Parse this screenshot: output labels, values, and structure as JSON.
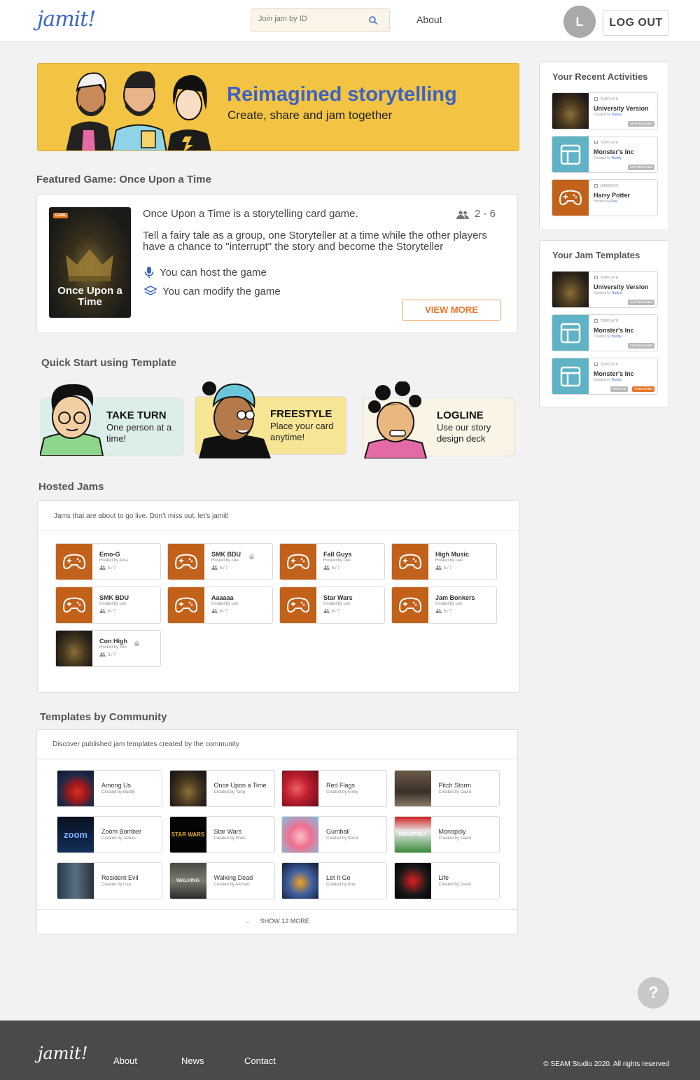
{
  "header": {
    "logo": "jamit!",
    "search_placeholder": "Join jam by ID",
    "nav_about": "About",
    "avatar_initial": "L",
    "logout_label": "LOG OUT"
  },
  "banner": {
    "title": "Reimagined storytelling",
    "subtitle": "Create, share and jam together"
  },
  "featured": {
    "section_title": "Featured Game: Once Upon a Time",
    "cover_badge": "GAME",
    "cover_title": "Once Upon a Time",
    "line1": "Once Upon a Time is a storytelling card game.",
    "players": "2 - 6",
    "description": "Tell a fairy tale as a group, one Storyteller at a time while the other players have a chance to \"interrupt\" the story and become the Storyteller",
    "host_text": "You can host the game",
    "modify_text": "You can modify the game",
    "view_more": "VIEW MORE"
  },
  "quickstart": {
    "section_title": "Quick Start using Template",
    "cards": [
      {
        "title": "TAKE TURN",
        "desc": "One person at a time!",
        "bg": "#dceee9"
      },
      {
        "title": "FREESTYLE",
        "desc": "Place your card anytime!",
        "bg": "#f5e595"
      },
      {
        "title": "LOGLINE",
        "desc": "Use our story design deck",
        "bg": "#f9f4e6"
      }
    ]
  },
  "hosted": {
    "section_title": "Hosted Jams",
    "subtitle": "Jams that are about to go live. Don’t miss out, let’s jamit!",
    "jams": [
      {
        "name": "Emo-G",
        "host": "Hosted by Avra",
        "count": "5 / 7",
        "locked": false
      },
      {
        "name": "SMK BDU",
        "host": "Hosted by Lee",
        "count": "6 / 7",
        "locked": true
      },
      {
        "name": "Fall Guys",
        "host": "Hosted by Lee",
        "count": "6 / 7",
        "locked": false
      },
      {
        "name": "High Music",
        "host": "Hosted by Lee",
        "count": "5 / 7",
        "locked": false
      },
      {
        "name": "SMK BDU",
        "host": "Hosted by Lee",
        "count": "6 / 7",
        "locked": false
      },
      {
        "name": "Aaaaaa",
        "host": "Hosted by Lee",
        "count": "6 / 7",
        "locked": false
      },
      {
        "name": "Star Wars",
        "host": "Hosted by Lee",
        "count": "6 / 7",
        "locked": false
      },
      {
        "name": "Jam Bonkers",
        "host": "Hosted by Lee",
        "count": "5 / 7",
        "locked": false
      },
      {
        "name": "Con High",
        "host": "Hosted by Yen",
        "count": "3 / 7",
        "locked": true
      }
    ]
  },
  "community": {
    "section_title": "Templates by Community",
    "subtitle": "Discover published jam templates created by the community",
    "templates": [
      {
        "name": "Among Us",
        "by": "Created by Buddy"
      },
      {
        "name": "Once Upon a Time",
        "by": "Created by Yang"
      },
      {
        "name": "Red Flags",
        "by": "Created by Emily"
      },
      {
        "name": "Pitch Storm",
        "by": "Created by David"
      },
      {
        "name": "Zoom Bomber",
        "by": "Created by James"
      },
      {
        "name": "Star Wars",
        "by": "Created by Shen"
      },
      {
        "name": "Gumball",
        "by": "Created by Bond"
      },
      {
        "name": "Monopoly",
        "by": "Created by David"
      },
      {
        "name": "Resident Evil",
        "by": "Created by Lisa"
      },
      {
        "name": "Walking Dead",
        "by": "Created by Aminah"
      },
      {
        "name": "Let It Go",
        "by": "Created by Ana"
      },
      {
        "name": "Life",
        "by": "Created by David"
      }
    ],
    "thumb_text": {
      "zoom": "zoom",
      "starwars": "STAR WARS",
      "monopoly": "MONOPOLY",
      "walking": "WALKING"
    },
    "show_more": "SHOW 12 MORE"
  },
  "recent": {
    "title": "Your Recent Activities",
    "items": [
      {
        "type": "TEMPLATE",
        "name": "University Version",
        "by_prefix": "Created by",
        "by": "Nadya",
        "status": "UNPUBLISHED"
      },
      {
        "type": "TEMPLATE",
        "name": "Monster's Inc",
        "by_prefix": "Created by",
        "by": "Buddy",
        "status": "UNPUBLISHED"
      },
      {
        "type": "JAMSPACE",
        "name": "Harry Potter",
        "by_prefix": "Hosted by",
        "by": "Rize",
        "status": ""
      }
    ]
  },
  "my_templates": {
    "title": "Your Jam Templates",
    "items": [
      {
        "type": "TEMPLATE",
        "name": "University Version",
        "by_prefix": "Created by",
        "by": "Nadya",
        "status": "UNPUBLISHED"
      },
      {
        "type": "TEMPLATE",
        "name": "Monster's Inc",
        "by_prefix": "Created by",
        "by": "Buddy",
        "status": "UNPUBLISHED"
      },
      {
        "type": "TEMPLATE",
        "name": "Monster's Inc",
        "by_prefix": "Created by",
        "by": "Buddy",
        "status": "PUBLISHED",
        "status2": "PRIVATE"
      }
    ]
  },
  "help_label": "?",
  "footer": {
    "logo": "jamit!",
    "links": [
      "About",
      "News",
      "Contact"
    ],
    "copyright": "© SEAM Studio 2020. All rights reserved"
  },
  "colors": {
    "accent_orange": "#e8762a",
    "brand_blue": "#3b62c4",
    "banner_yellow": "#f3c443",
    "jam_thumb": "#c1611a",
    "template_teal": "#5fb3c4"
  }
}
